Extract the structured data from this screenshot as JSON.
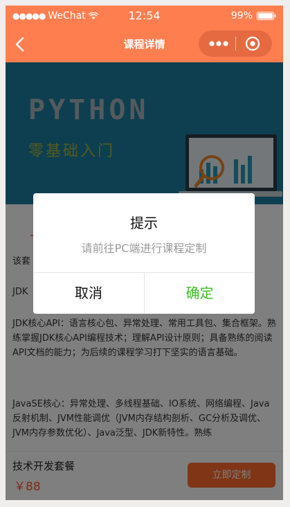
{
  "status": {
    "carrier": "WeChat",
    "time": "12:54",
    "battery": "99%"
  },
  "nav": {
    "title": "课程详情"
  },
  "banner": {
    "title": "PYTHON",
    "subtitle": "零基础入门"
  },
  "content": {
    "intro": "该套",
    "jdk": "JDK",
    "core": "JDK核心API：语言核心包、异常处理、常用工具包、集合框架。熟练掌握JDK核心API编程技术；理解API设计原则；具备熟练的阅读API文档的能力；为后续的课程学习打下坚实的语言基础。",
    "se": "JavaSE核心：异常处理、多线程基础、IO系统、网络编程、Java反射机制、JVM性能调优（JVM内存结构剖析、GC分析及调优、JVM内存参数优化）、Java泛型、JDK新特性。熟练"
  },
  "bottom": {
    "package_name": "技术开发套餐",
    "price": "￥88",
    "order_label": "立即定制"
  },
  "modal": {
    "title": "提示",
    "message": "请前往PC端进行课程定制",
    "cancel_label": "取消",
    "confirm_label": "确定",
    "confirm_color": "#3cbb25"
  },
  "colors": {
    "brand": "#ff7e4f",
    "price": "#ff5722"
  }
}
